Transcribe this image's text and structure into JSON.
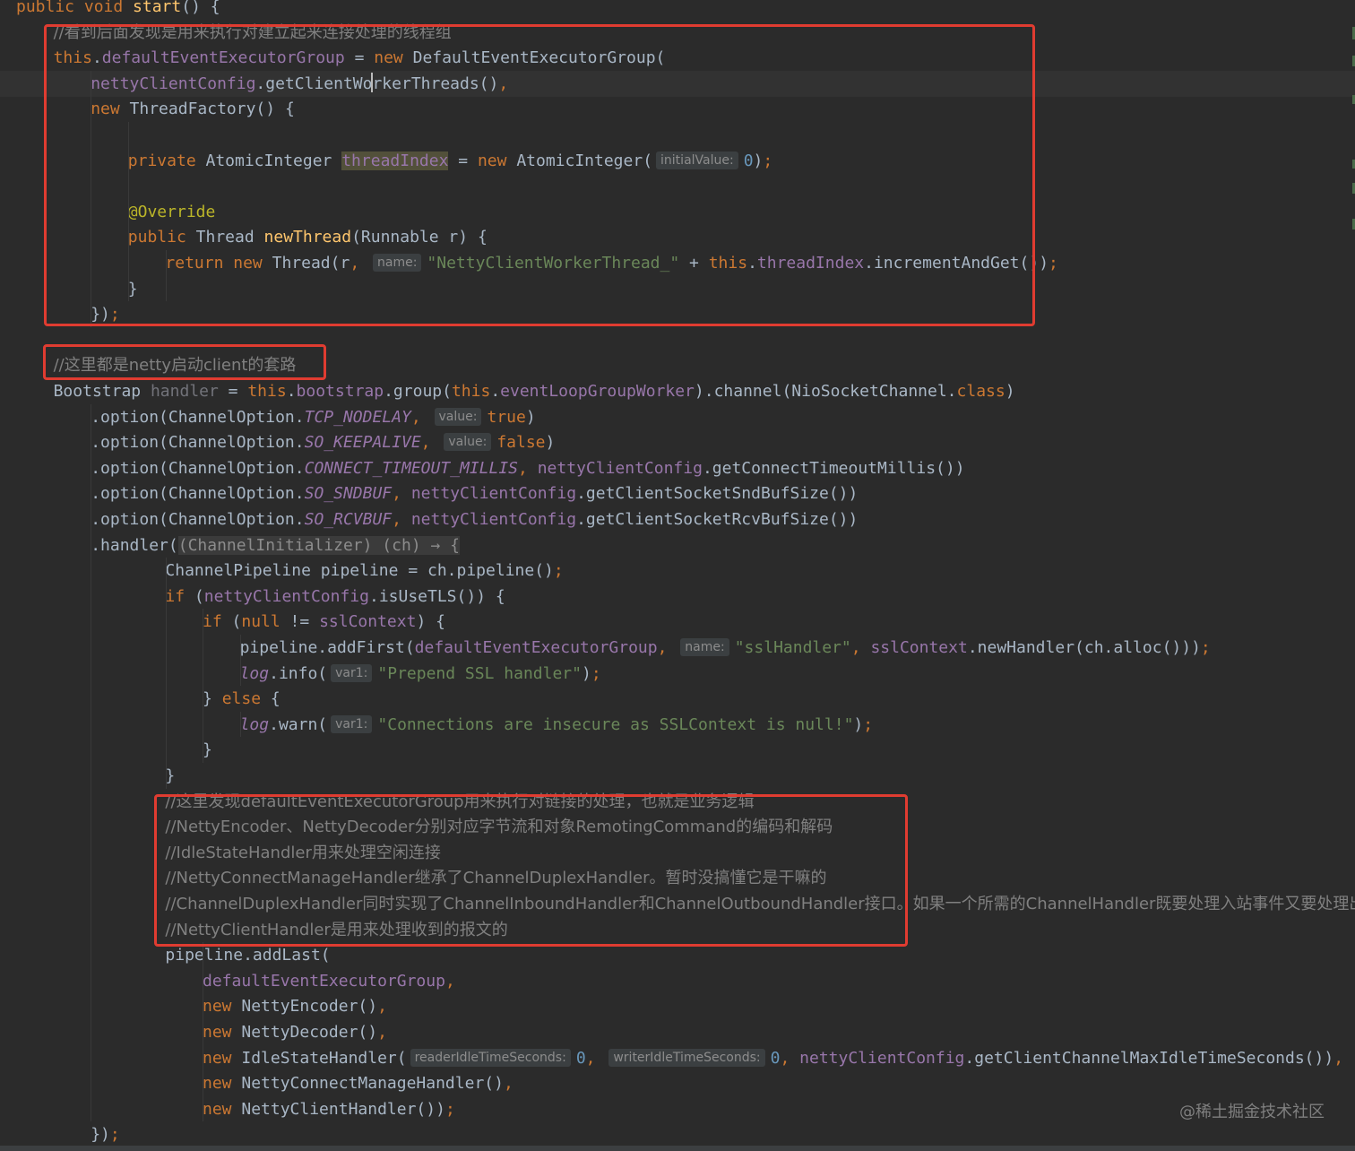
{
  "editor": {
    "lines": [
      {
        "i": 0,
        "segs": [
          [
            "kw",
            "public void "
          ],
          [
            "fn",
            "start"
          ],
          [
            "plain",
            "() {"
          ]
        ]
      },
      {
        "i": 1,
        "segs": [
          [
            "cmt",
            "//看到后面发现是用来执行对建立起来连接处理的线程组"
          ]
        ]
      },
      {
        "i": 2,
        "segs": [
          [
            "kw",
            "this"
          ],
          [
            "plain",
            "."
          ],
          [
            "fld",
            "defaultEventExecutorGroup"
          ],
          [
            "plain",
            " = "
          ],
          [
            "kw",
            "new "
          ],
          [
            "plain",
            "DefaultEventExecutorGroup("
          ]
        ]
      },
      {
        "i": 3,
        "current": true,
        "segs": [
          [
            "fld",
            "nettyClientConfig"
          ],
          [
            "plain",
            ".getClientWo"
          ],
          [
            "caret",
            ""
          ],
          [
            "plain",
            "rkerThreads()"
          ],
          [
            "kw",
            ","
          ]
        ]
      },
      {
        "i": 4,
        "segs": [
          [
            "kw",
            "new "
          ],
          [
            "plain",
            "ThreadFactory() {"
          ]
        ]
      },
      {
        "i": 5,
        "segs": []
      },
      {
        "i": 6,
        "segs": [
          [
            "kw",
            "private "
          ],
          [
            "plain",
            "AtomicInteger "
          ],
          [
            "fldhl",
            "threadIndex"
          ],
          [
            "plain",
            " = "
          ],
          [
            "kw",
            "new "
          ],
          [
            "plain",
            "AtomicInteger("
          ],
          [
            "hint",
            "initialValue:"
          ],
          [
            "num",
            "0"
          ],
          [
            "plain",
            ")"
          ],
          [
            "kw",
            ";"
          ]
        ]
      },
      {
        "i": 7,
        "segs": []
      },
      {
        "i": 8,
        "segs": [
          [
            "ann",
            "@Override"
          ]
        ]
      },
      {
        "i": 9,
        "segs": [
          [
            "kw",
            "public "
          ],
          [
            "plain",
            "Thread "
          ],
          [
            "fn",
            "newThread"
          ],
          [
            "plain",
            "(Runnable r) {"
          ]
        ]
      },
      {
        "i": 10,
        "segs": [
          [
            "kw",
            "return new "
          ],
          [
            "plain",
            "Thread(r"
          ],
          [
            "kw",
            ", "
          ],
          [
            "hint",
            "name:"
          ],
          [
            "str",
            "\"NettyClientWorkerThread_\""
          ],
          [
            "plain",
            " + "
          ],
          [
            "kw",
            "this"
          ],
          [
            "plain",
            "."
          ],
          [
            "fld",
            "threadIndex"
          ],
          [
            "plain",
            ".incrementAndGet())"
          ],
          [
            "kw",
            ";"
          ]
        ]
      },
      {
        "i": 11,
        "segs": [
          [
            "plain",
            "}"
          ]
        ]
      },
      {
        "i": 12,
        "segs": [
          [
            "plain",
            "})"
          ],
          [
            "kw",
            ";"
          ]
        ]
      },
      {
        "i": 13,
        "segs": []
      },
      {
        "i": 14,
        "segs": [
          [
            "cmt",
            "//这里都是netty启动client的套路"
          ]
        ]
      },
      {
        "i": 15,
        "segs": [
          [
            "plain",
            "Bootstrap "
          ],
          [
            "unused",
            "handler"
          ],
          [
            "plain",
            " = "
          ],
          [
            "kw",
            "this"
          ],
          [
            "plain",
            "."
          ],
          [
            "fld",
            "bootstrap"
          ],
          [
            "plain",
            ".group("
          ],
          [
            "kw",
            "this"
          ],
          [
            "plain",
            "."
          ],
          [
            "fld",
            "eventLoopGroupWorker"
          ],
          [
            "plain",
            ").channel(NioSocketChannel."
          ],
          [
            "kw",
            "class"
          ],
          [
            "plain",
            ")"
          ]
        ]
      },
      {
        "i": 16,
        "segs": [
          [
            "plain",
            ".option(ChannelOption."
          ],
          [
            "sf",
            "TCP_NODELAY"
          ],
          [
            "kw",
            ", "
          ],
          [
            "hint",
            "value:"
          ],
          [
            "kw",
            "true"
          ],
          [
            "plain",
            ")"
          ]
        ]
      },
      {
        "i": 17,
        "segs": [
          [
            "plain",
            ".option(ChannelOption."
          ],
          [
            "sf",
            "SO_KEEPALIVE"
          ],
          [
            "kw",
            ", "
          ],
          [
            "hint",
            "value:"
          ],
          [
            "kw",
            "false"
          ],
          [
            "plain",
            ")"
          ]
        ]
      },
      {
        "i": 18,
        "segs": [
          [
            "plain",
            ".option(ChannelOption."
          ],
          [
            "sf",
            "CONNECT_TIMEOUT_MILLIS"
          ],
          [
            "kw",
            ", "
          ],
          [
            "fld",
            "nettyClientConfig"
          ],
          [
            "plain",
            ".getConnectTimeoutMillis())"
          ]
        ]
      },
      {
        "i": 19,
        "segs": [
          [
            "plain",
            ".option(ChannelOption."
          ],
          [
            "sf",
            "SO_SNDBUF"
          ],
          [
            "kw",
            ", "
          ],
          [
            "fld",
            "nettyClientConfig"
          ],
          [
            "plain",
            ".getClientSocketSndBufSize())"
          ]
        ]
      },
      {
        "i": 20,
        "segs": [
          [
            "plain",
            ".option(ChannelOption."
          ],
          [
            "sf",
            "SO_RCVBUF"
          ],
          [
            "kw",
            ", "
          ],
          [
            "fld",
            "nettyClientConfig"
          ],
          [
            "plain",
            ".getClientSocketRcvBufSize())"
          ]
        ]
      },
      {
        "i": 21,
        "segs": [
          [
            "plain",
            ".handler("
          ],
          [
            "fold",
            "(ChannelInitializer) (ch) → {"
          ]
        ]
      },
      {
        "i": 22,
        "segs": [
          [
            "plain",
            "ChannelPipeline pipeline = ch.pipeline()"
          ],
          [
            "kw",
            ";"
          ]
        ]
      },
      {
        "i": 23,
        "segs": [
          [
            "kw",
            "if "
          ],
          [
            "plain",
            "("
          ],
          [
            "fld",
            "nettyClientConfig"
          ],
          [
            "plain",
            ".isUseTLS()) {"
          ]
        ]
      },
      {
        "i": 24,
        "segs": [
          [
            "kw",
            "if "
          ],
          [
            "plain",
            "("
          ],
          [
            "kw",
            "null "
          ],
          [
            "plain",
            "!= "
          ],
          [
            "fld",
            "sslContext"
          ],
          [
            "plain",
            ") {"
          ]
        ]
      },
      {
        "i": 25,
        "segs": [
          [
            "plain",
            "pipeline.addFirst("
          ],
          [
            "fld",
            "defaultEventExecutorGroup"
          ],
          [
            "kw",
            ", "
          ],
          [
            "hint",
            "name:"
          ],
          [
            "str",
            "\"sslHandler\""
          ],
          [
            "kw",
            ", "
          ],
          [
            "fld",
            "sslContext"
          ],
          [
            "plain",
            ".newHandler(ch.alloc()))"
          ],
          [
            "kw",
            ";"
          ]
        ]
      },
      {
        "i": 26,
        "segs": [
          [
            "sf",
            "log"
          ],
          [
            "plain",
            ".info("
          ],
          [
            "hint",
            "var1:"
          ],
          [
            "str",
            "\"Prepend SSL handler\""
          ],
          [
            "plain",
            ")"
          ],
          [
            "kw",
            ";"
          ]
        ]
      },
      {
        "i": 27,
        "segs": [
          [
            "plain",
            "} "
          ],
          [
            "kw",
            "else "
          ],
          [
            "plain",
            "{"
          ]
        ]
      },
      {
        "i": 28,
        "segs": [
          [
            "sf",
            "log"
          ],
          [
            "plain",
            ".warn("
          ],
          [
            "hint",
            "var1:"
          ],
          [
            "str",
            "\"Connections are insecure as SSLContext is null!\""
          ],
          [
            "plain",
            ")"
          ],
          [
            "kw",
            ";"
          ]
        ]
      },
      {
        "i": 29,
        "segs": [
          [
            "plain",
            "}"
          ]
        ]
      },
      {
        "i": 30,
        "segs": [
          [
            "plain",
            "}"
          ]
        ]
      },
      {
        "i": 31,
        "segs": [
          [
            "cmt",
            "//这里发现defaultEventExecutorGroup用来执行对链接的处理，也就是业务逻辑"
          ]
        ]
      },
      {
        "i": 32,
        "segs": [
          [
            "cmt",
            "//NettyEncoder、NettyDecoder分别对应字节流和对象RemotingCommand的编码和解码"
          ]
        ]
      },
      {
        "i": 33,
        "segs": [
          [
            "cmt",
            "//IdleStateHandler用来处理空闲连接"
          ]
        ]
      },
      {
        "i": 34,
        "segs": [
          [
            "cmt",
            "//NettyConnectManageHandler继承了ChannelDuplexHandler。暂时没搞懂它是干嘛的"
          ]
        ]
      },
      {
        "i": 35,
        "segs": [
          [
            "cmt",
            "//ChannelDuplexHandler同时实现了ChannelInboundHandler和ChannelOutboundHandler接口。如果一个所需的ChannelHandler既要处理入站事件又要处理出站"
          ]
        ]
      },
      {
        "i": 36,
        "segs": [
          [
            "cmt",
            "//NettyClientHandler是用来处理收到的报文的"
          ]
        ]
      },
      {
        "i": 37,
        "segs": [
          [
            "plain",
            "pipeline.addLast("
          ]
        ]
      },
      {
        "i": 38,
        "segs": [
          [
            "fld",
            "defaultEventExecutorGroup"
          ],
          [
            "kw",
            ","
          ]
        ]
      },
      {
        "i": 39,
        "segs": [
          [
            "kw",
            "new "
          ],
          [
            "plain",
            "NettyEncoder()"
          ],
          [
            "kw",
            ","
          ]
        ]
      },
      {
        "i": 40,
        "segs": [
          [
            "kw",
            "new "
          ],
          [
            "plain",
            "NettyDecoder()"
          ],
          [
            "kw",
            ","
          ]
        ]
      },
      {
        "i": 41,
        "segs": [
          [
            "kw",
            "new "
          ],
          [
            "plain",
            "IdleStateHandler("
          ],
          [
            "hint",
            "readerIdleTimeSeconds:"
          ],
          [
            "num",
            "0"
          ],
          [
            "kw",
            ", "
          ],
          [
            "hint",
            "writerIdleTimeSeconds:"
          ],
          [
            "num",
            "0"
          ],
          [
            "kw",
            ", "
          ],
          [
            "fld",
            "nettyClientConfig"
          ],
          [
            "plain",
            ".getClientChannelMaxIdleTimeSeconds())"
          ],
          [
            "kw",
            ","
          ]
        ]
      },
      {
        "i": 42,
        "segs": [
          [
            "kw",
            "new "
          ],
          [
            "plain",
            "NettyConnectManageHandler()"
          ],
          [
            "kw",
            ","
          ]
        ]
      },
      {
        "i": 43,
        "segs": [
          [
            "kw",
            "new "
          ],
          [
            "plain",
            "NettyClientHandler())"
          ],
          [
            "kw",
            ";"
          ]
        ]
      },
      {
        "i": 44,
        "segs": [
          [
            "plain",
            "})"
          ],
          [
            "kw",
            ";"
          ]
        ]
      }
    ]
  },
  "watermark": "@稀土掘金技术社区"
}
